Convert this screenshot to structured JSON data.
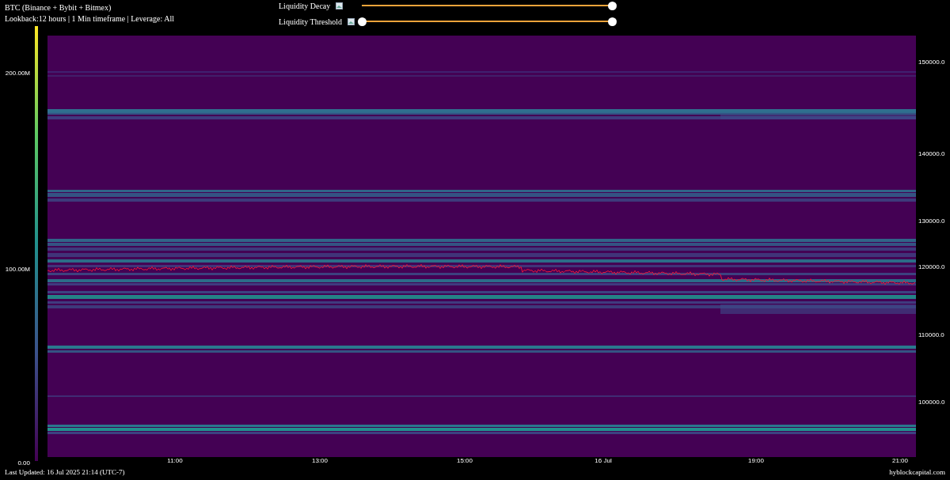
{
  "header": {
    "title": "BTC (Binance + Bybit + Bitmex)",
    "subtitle": "Lookback:12 hours | 1 Min timeframe | Leverage: All"
  },
  "sliders": [
    {
      "kind": "single",
      "label": "Liquidity Decay",
      "handles": [
        {
          "level": 1
        }
      ]
    },
    {
      "kind": "range",
      "label": "Liquidity Threshold",
      "handles": [
        {
          "level": 0
        },
        {
          "level": 1
        }
      ]
    }
  ],
  "heatmap": {
    "colorbar_ticks": [
      "200.00M",
      "100.00M",
      "0.00"
    ],
    "y_ticks": [
      "150000.0",
      "140000.0",
      "130000.0",
      "120000.0",
      "110000.0",
      "100000.0"
    ],
    "x_ticks": [
      "11:00",
      "13:00",
      "15:00",
      "16 Jul",
      "19:00",
      "21:00"
    ]
  },
  "footer": {
    "updated": "Last Updated: 16 Jul 2025 21:14 (UTC-7)",
    "site": "hyblockcapital.com"
  }
}
